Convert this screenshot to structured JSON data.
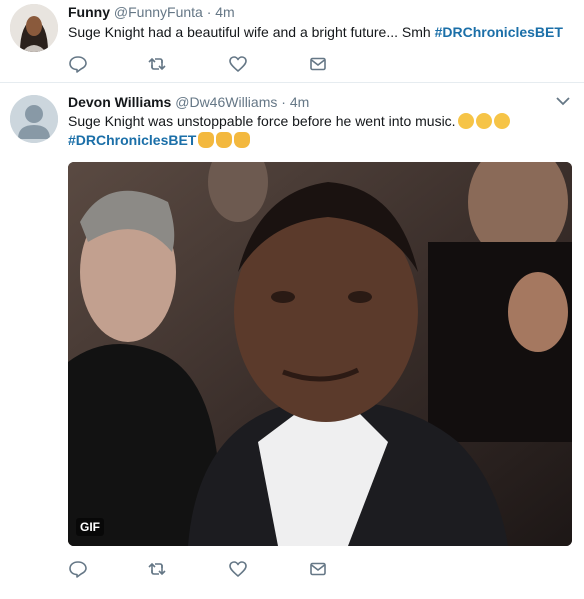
{
  "tweets": [
    {
      "name": "Funny",
      "handle": "@FunnyFunta",
      "separator": "·",
      "time": "4m",
      "text": "Suge Knight had a beautiful wife and a bright future... Smh ",
      "hashtag": "#DRChroniclesBET"
    },
    {
      "name": "Devon Williams",
      "handle": "@Dw46Williams",
      "separator": "·",
      "time": "4m",
      "text": "Suge Knight was unstoppable force before he went into music.",
      "hashtag": "#DRChroniclesBET",
      "media_badge": "GIF",
      "emoji_line1": [
        "confused-face",
        "worried-face",
        "smirking-face"
      ],
      "emoji_line2": [
        "thumbs-up",
        "raised-fist",
        "clapping-hands"
      ]
    }
  ],
  "icons": [
    "reply-icon",
    "retweet-icon",
    "like-icon",
    "direct-message-icon",
    "caret-down-icon"
  ],
  "colors": {
    "hashtag": "#1b6fa8",
    "meta": "#657786",
    "icon": "#657786",
    "divider": "#e6ecf0"
  }
}
